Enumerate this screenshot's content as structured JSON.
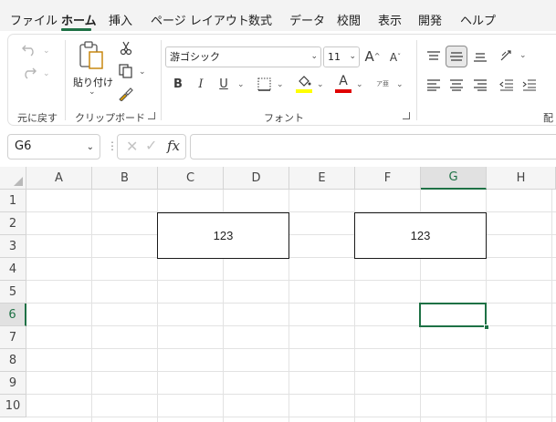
{
  "menu": {
    "tabs": [
      "ファイル",
      "ホーム",
      "挿入",
      "ページ レイアウト",
      "数式",
      "データ",
      "校閲",
      "表示",
      "開発",
      "ヘルプ"
    ],
    "active_tab": "ホーム"
  },
  "ribbon": {
    "undo_group_label": "元に戻す",
    "clipboard_group_label": "クリップボード",
    "paste_label": "貼り付け",
    "font_group_label": "フォント",
    "alignment_group_label_partial": "配",
    "font_name": "游ゴシック",
    "font_size": "11",
    "font_grow": "A",
    "font_shrink": "A",
    "bold": "B",
    "italic": "I",
    "underline": "U",
    "font_color_letter": "A",
    "phonetic_glyph": "ア亜",
    "highlight_color": "#ffff00",
    "font_color": "#e00000"
  },
  "formula_bar": {
    "name_box": "G6",
    "formula": "",
    "fx_label": "fx"
  },
  "sheet": {
    "columns": [
      "A",
      "B",
      "C",
      "D",
      "E",
      "F",
      "G",
      "H"
    ],
    "rows": [
      "1",
      "2",
      "3",
      "4",
      "5",
      "6",
      "7",
      "8",
      "9",
      "10"
    ],
    "active_column": "G",
    "active_row": "6",
    "merged_cells": [
      {
        "range": "C2:D3",
        "value": "123"
      },
      {
        "range": "F2:G3",
        "value": "123"
      }
    ]
  },
  "colors": {
    "accent": "#1e7145",
    "menu_bg": "#f3f3f3"
  }
}
